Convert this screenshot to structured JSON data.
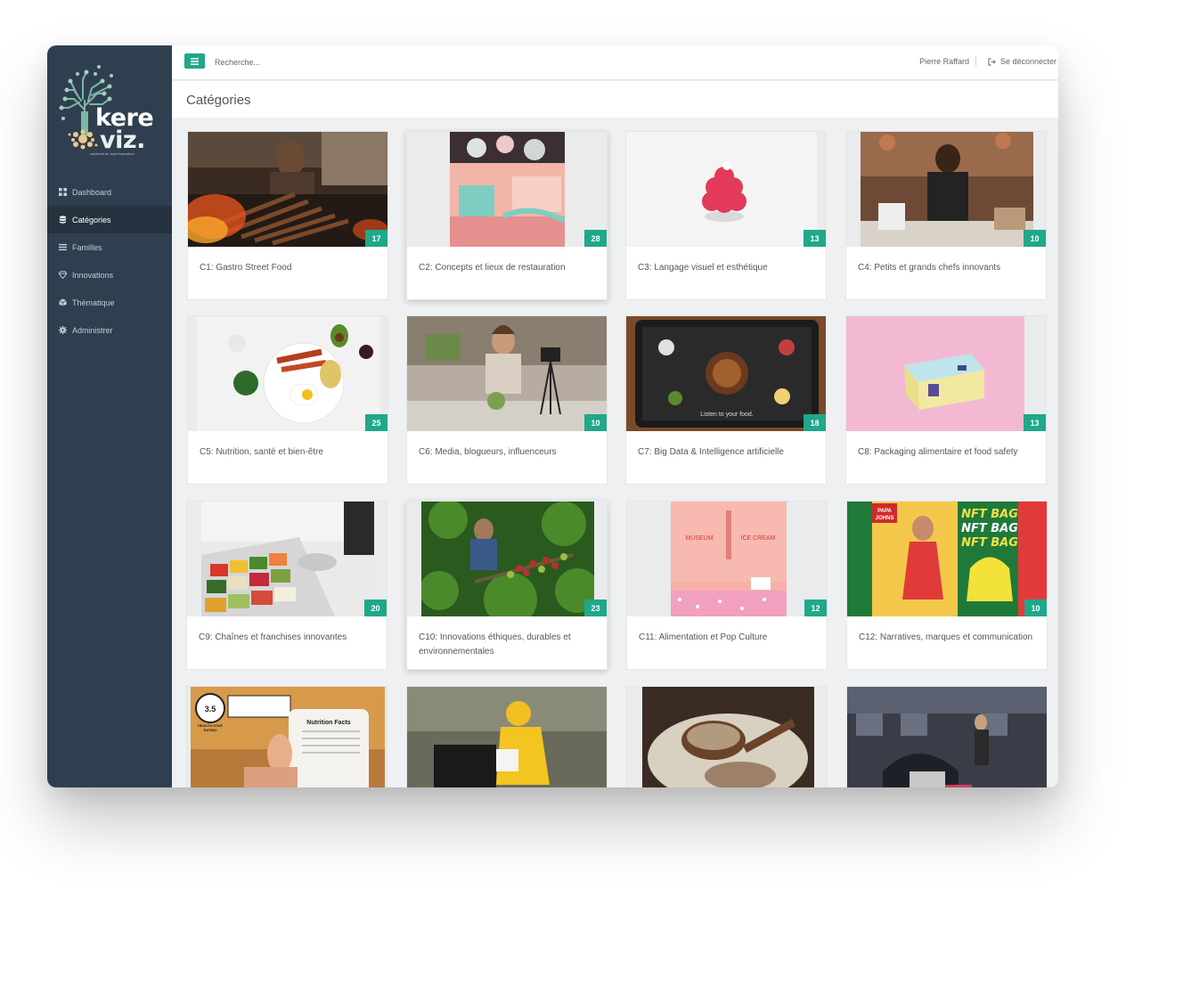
{
  "brand": {
    "name_line1": "kere",
    "name_line2": "viz.",
    "tagline": "solutions for food innovation"
  },
  "topbar": {
    "search_placeholder": "Recherche...",
    "user_name": "Pierre Raffard",
    "logout_label": "Se déconnecter"
  },
  "page": {
    "title": "Catégories"
  },
  "nav": {
    "items": [
      {
        "label": "Dashboard",
        "icon": "grid-icon"
      },
      {
        "label": "Catégories",
        "icon": "database-icon"
      },
      {
        "label": "Familles",
        "icon": "list-icon"
      },
      {
        "label": "Innovations",
        "icon": "diamond-icon"
      },
      {
        "label": "Thématique",
        "icon": "box-icon"
      },
      {
        "label": "Administrer",
        "icon": "gear-icon"
      }
    ],
    "active": "Catégories"
  },
  "categories": [
    {
      "title": "C1: Gastro Street Food",
      "count": "17",
      "image": "street-food-grill-photo"
    },
    {
      "title": "C2: Concepts et lieux de restauration",
      "count": "28",
      "image": "pink-restaurant-interior-photo"
    },
    {
      "title": "C3: Langage visuel et esthétique",
      "count": "13",
      "image": "pink-dessert-photo"
    },
    {
      "title": "C4: Petits et grands chefs innovants",
      "count": "10",
      "image": "chef-kitchen-photo"
    },
    {
      "title": "C5: Nutrition, santé et bien-être",
      "count": "25",
      "image": "healthy-breakfast-photo"
    },
    {
      "title": "C6: Media, blogueurs, influenceurs",
      "count": "10",
      "image": "food-blogger-photo"
    },
    {
      "title": "C7: Big Data & Intelligence artificielle",
      "count": "18",
      "image": "food-tablet-photo"
    },
    {
      "title": "C8: Packaging alimentaire et food safety",
      "count": "13",
      "image": "food-box-packaging-photo"
    },
    {
      "title": "C9: Chaînes et franchises innovantes",
      "count": "20",
      "image": "salad-bar-photo"
    },
    {
      "title": "C10: Innovations éthiques, durables et environnementales",
      "count": "23",
      "image": "coffee-harvest-photo"
    },
    {
      "title": "C11: Alimentation et Pop Culture",
      "count": "12",
      "image": "museum-ice-cream-photo"
    },
    {
      "title": "C12: Narratives, marques et communication",
      "count": "10",
      "image": "papa-johns-nft-bag-photo",
      "image_text": [
        "PAPA",
        "JOHNS",
        "NFT BAG",
        "NFT BAG",
        "NFT BAG"
      ]
    },
    {
      "title": "",
      "count": "",
      "image": "nutrition-label-photo",
      "image_text": [
        "3.5",
        "HEALTH STAR",
        "RATING",
        "Nutrition Facts"
      ]
    },
    {
      "title": "",
      "count": "",
      "image": "delivery-courier-photo"
    },
    {
      "title": "",
      "count": "",
      "image": "quinoa-bowl-photo"
    },
    {
      "title": "",
      "count": "",
      "image": "robot-restaurant-photo"
    }
  ],
  "museum_text": [
    "MUSEUM",
    "ICE CREAM"
  ],
  "tablet_text": "Listen to your food.",
  "colors": {
    "sidebar": "#2f3f50",
    "sidebar_active": "#26323f",
    "accent": "#1fa88a"
  }
}
